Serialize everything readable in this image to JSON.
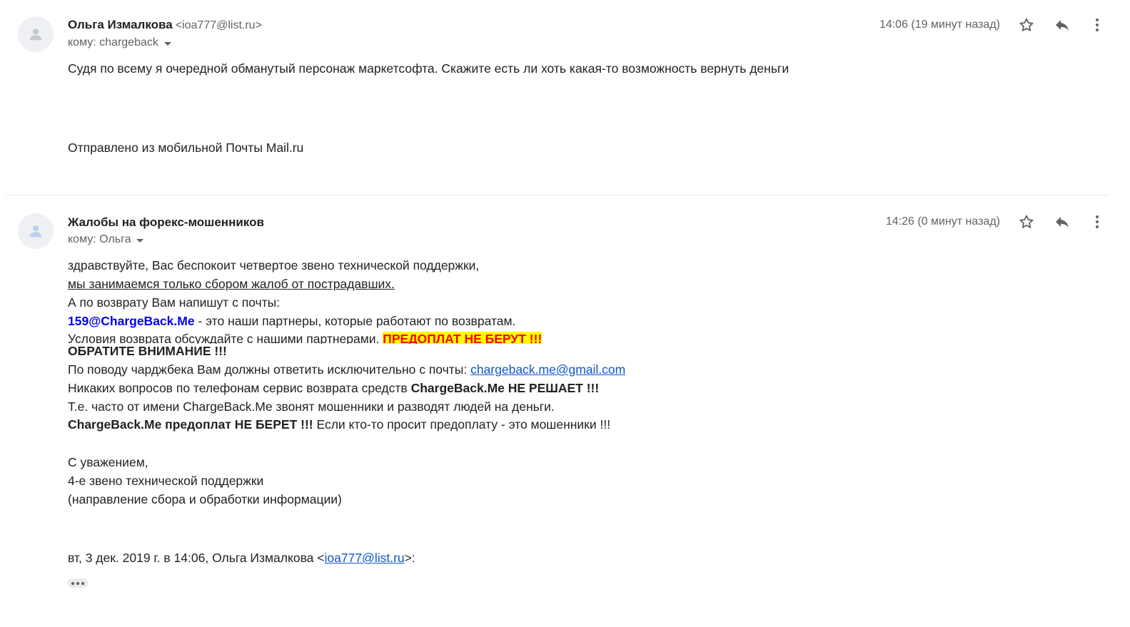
{
  "message1": {
    "sender_name": "Ольга Измалкова",
    "sender_email": "<ioa777@list.ru>",
    "to_label": "кому: chargeback",
    "time": "14:06 (19 минут назад)",
    "body_line1": "Судя по всему я очередной обманутый персонаж маркетсофта. Скажите есть ли хоть какая-то возможность вернуть деньги",
    "body_line2": "Отправлено из мобильной Почты Mail.ru"
  },
  "message2": {
    "sender_name": "Жалобы на форекс-мошенников",
    "to_label": "кому: Ольга",
    "time": "14:26 (0 минут назад)",
    "l1": "здравствуйте, Вас беспокоит четвертое звено технической поддержки,",
    "l2": "мы занимаемся только сбором жалоб от пострадавших.",
    "l3": "А по возврату Вам напишут с почты:",
    "l4_email": "159@ChargeBack.Me",
    "l4_rest": " - это наши партнеры, которые работают по возвратам.",
    "l5_text": "Условия возврата обсуждайте с нашими партнерами. ",
    "l5_highlight": "ПРЕДОПЛАТ НЕ БЕРУТ !!!",
    "l6": "ОБРАТИТЕ ВНИМАНИЕ !!!",
    "l7_text": "По поводу чарджбека Вам должны ответить исключительно с почты: ",
    "l7_link": "chargeback.me@gmail.com",
    "l8_text": "Никаких вопросов по телефонам сервис возврата средств ",
    "l8_bold": "ChargeBack.Me НЕ РЕШАЕТ !!!",
    "l9": "Т.е. часто от имени ChargeBack.Me звонят мошенники и разводят людей на деньги.",
    "l10_bold": "ChargeBack.Me предоплат НЕ БЕРЕТ !!!",
    "l10_rest": " Если кто-то просит предоплату - это мошенники !!!",
    "l11": "С уважением,",
    "l12": "4-е звено технической поддержки",
    "l13": "(направление сбора и обработки информации)",
    "quote_pre": "вт, 3 дек. 2019 г. в 14:06, Ольга Измалкова <",
    "quote_link": "ioa777@list.ru",
    "quote_post": ">:"
  },
  "icons": [
    "person-icon",
    "star-icon",
    "reply-icon",
    "more-vert-icon",
    "show-trimmed-icon"
  ]
}
